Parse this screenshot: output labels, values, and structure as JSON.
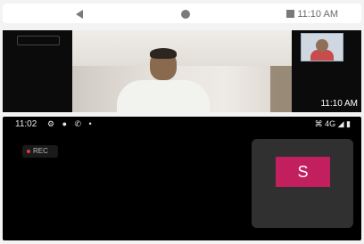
{
  "nav": {
    "back_icon": "back-triangle-icon",
    "home_icon": "home-circle-icon",
    "recents_icon": "recents-square-icon",
    "time": "11:10 AM"
  },
  "video_call": {
    "rec_label": "",
    "overlay_time": "11:10 AM",
    "participant_label": ""
  },
  "status_bar": {
    "time": "11:02",
    "left_icons": "⚙ ● ✆ •",
    "right_status": "⌘ 4G ◢ ▮"
  },
  "meeting": {
    "rec_label": "REC",
    "avatar_letter": "S",
    "avatar_color": "#c21f5e"
  }
}
